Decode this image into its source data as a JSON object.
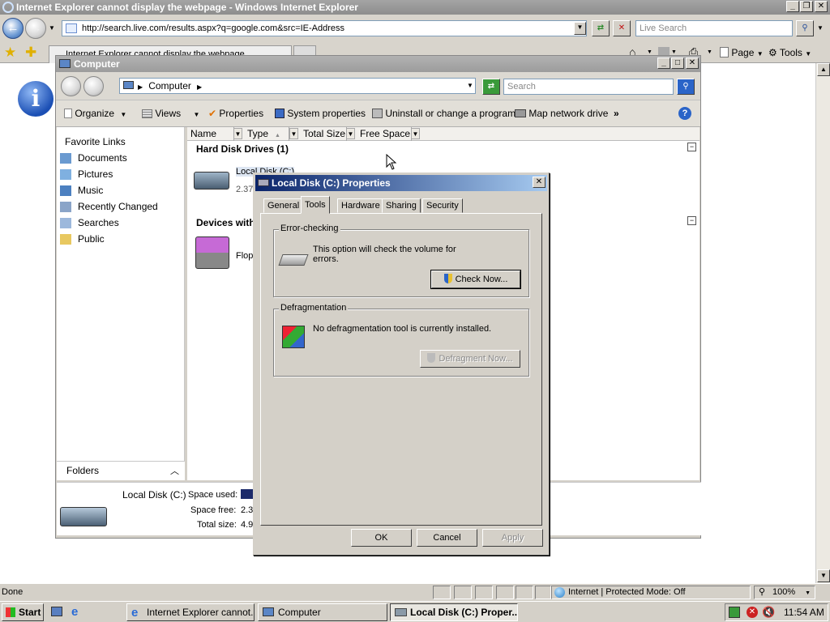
{
  "ie": {
    "title": "Internet Explorer cannot display the webpage - Windows Internet Explorer",
    "address": "http://search.live.com/results.aspx?q=google.com&src=IE-Address",
    "search_placeholder": "Live Search",
    "tab_title": "Internet Explorer cannot display the webpage",
    "cmd_page": "Page",
    "cmd_tools": "Tools",
    "status_text": "Done",
    "zone_text": "Internet | Protected Mode: Off",
    "zoom": "100%"
  },
  "explorer": {
    "title": "Computer",
    "breadcrumb": "Computer",
    "search_placeholder": "Search",
    "toolbar": {
      "organize": "Organize",
      "views": "Views",
      "properties": "Properties",
      "system_properties": "System properties",
      "uninstall": "Uninstall or change a program",
      "map_drive": "Map network drive",
      "more": "»"
    },
    "favorites_header": "Favorite Links",
    "favorites": [
      "Documents",
      "Pictures",
      "Music",
      "Recently Changed",
      "Searches",
      "Public"
    ],
    "folders_label": "Folders",
    "columns": [
      "Name",
      "Type",
      "Total Size",
      "Free Space"
    ],
    "groups": {
      "hdd": "Hard Disk Drives (1)",
      "devices": "Devices with"
    },
    "drive_c": {
      "label": "Local Disk (C:)",
      "size": "2.37"
    },
    "floppy": {
      "label": "Flopp"
    },
    "details": {
      "name": "Local Disk (C:)",
      "space_used_label": "Space used:",
      "space_free_label": "Space free:",
      "space_free_value": "2.3",
      "total_size_label": "Total size:",
      "total_size_value": "4.9"
    }
  },
  "dialog": {
    "title": "Local Disk (C:) Properties",
    "tabs": [
      "General",
      "Tools",
      "Hardware",
      "Sharing",
      "Security"
    ],
    "active_tab": "Tools",
    "error_group": "Error-checking",
    "error_text": "This option will check the volume for errors.",
    "check_now": "Check Now...",
    "defrag_group": "Defragmentation",
    "defrag_text": "No defragmentation tool is currently installed.",
    "defrag_now": "Defragment Now...",
    "ok": "OK",
    "cancel": "Cancel",
    "apply": "Apply"
  },
  "taskbar": {
    "start": "Start",
    "items": [
      "Internet Explorer cannot...",
      "Computer",
      "Local Disk (C:) Proper..."
    ],
    "clock": "11:54 AM"
  }
}
